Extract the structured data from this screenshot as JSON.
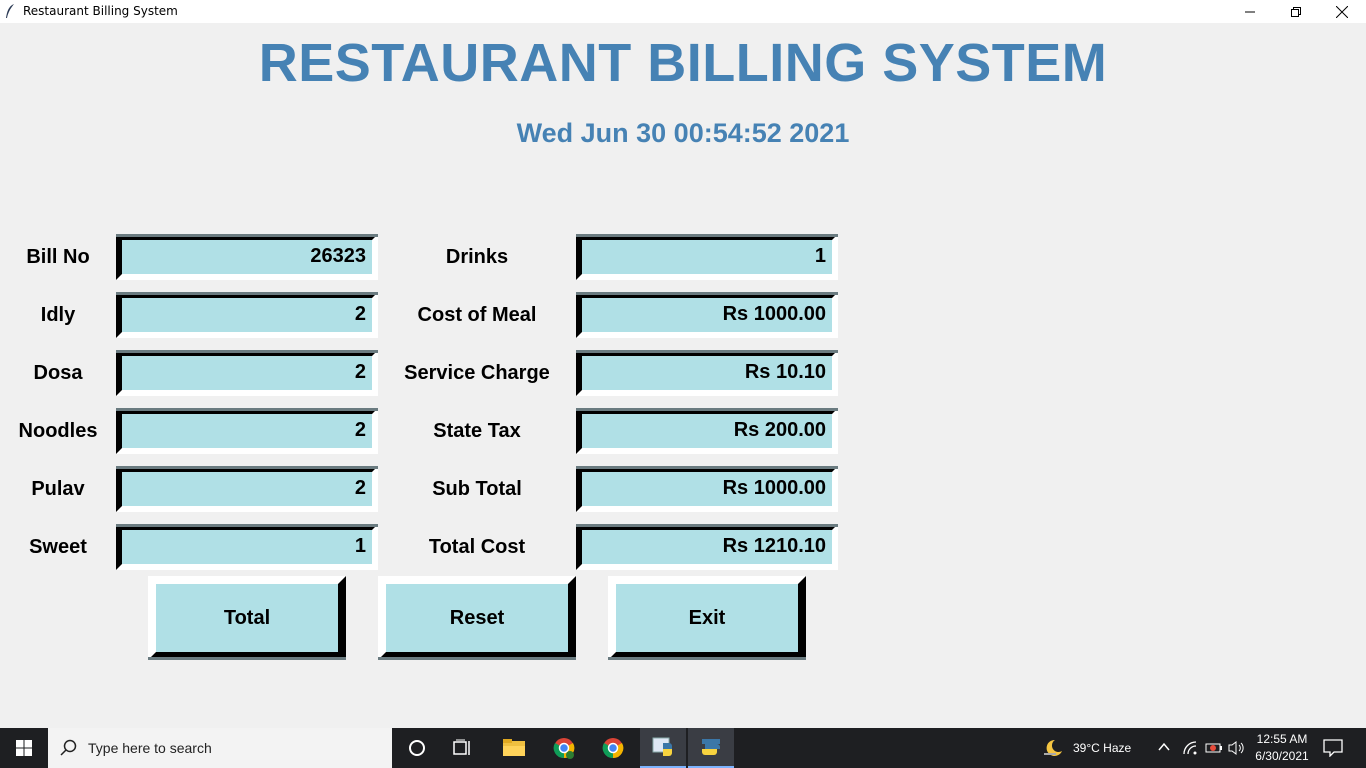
{
  "window": {
    "title": "Restaurant Billing System"
  },
  "header": {
    "title": "RESTAURANT BILLING SYSTEM",
    "datetime": "Wed Jun 30 00:54:52 2021"
  },
  "form": {
    "left": [
      {
        "label": "Bill No",
        "value": "26323"
      },
      {
        "label": "Idly",
        "value": "2"
      },
      {
        "label": "Dosa",
        "value": "2"
      },
      {
        "label": "Noodles",
        "value": "2"
      },
      {
        "label": "Pulav",
        "value": "2"
      },
      {
        "label": "Sweet",
        "value": "1"
      }
    ],
    "right": [
      {
        "label": "Drinks",
        "value": "1"
      },
      {
        "label": "Cost of Meal",
        "value": "Rs 1000.00"
      },
      {
        "label": "Service Charge",
        "value": "Rs 10.10"
      },
      {
        "label": "State Tax",
        "value": "Rs 200.00"
      },
      {
        "label": "Sub Total",
        "value": "Rs 1000.00"
      },
      {
        "label": "Total Cost",
        "value": "Rs 1210.10"
      }
    ]
  },
  "buttons": {
    "total": "Total",
    "reset": "Reset",
    "exit": "Exit"
  },
  "taskbar": {
    "search_placeholder": "Type here to search",
    "weather": "39°C  Haze",
    "time": "12:55 AM",
    "date": "6/30/2021"
  },
  "colors": {
    "heading": "#4682b4",
    "field_bg": "#b0e0e6",
    "window_bg": "#f0f0f0"
  }
}
